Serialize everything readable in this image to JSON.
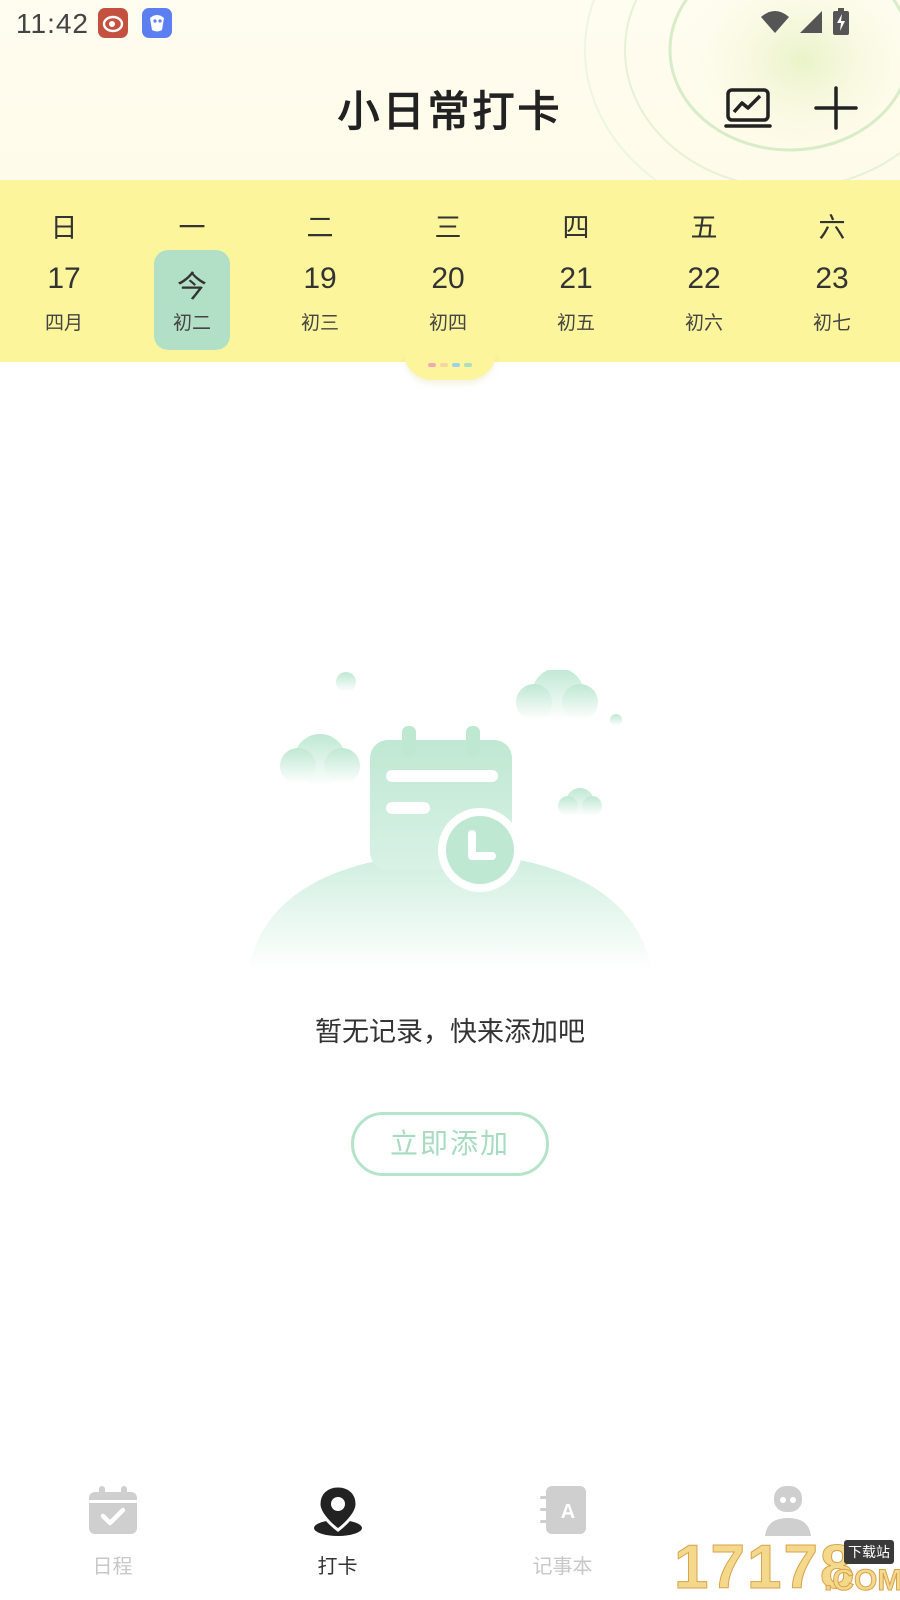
{
  "status_bar": {
    "time": "11:42"
  },
  "header": {
    "title": "小日常打卡",
    "stats_icon": "chart-icon",
    "add_icon": "plus-icon"
  },
  "week": {
    "weekdays": [
      "日",
      "一",
      "二",
      "三",
      "四",
      "五",
      "六"
    ],
    "days": [
      {
        "num": "17",
        "lunar": "四月",
        "today": false
      },
      {
        "num": "今",
        "lunar": "初二",
        "today": true
      },
      {
        "num": "19",
        "lunar": "初三",
        "today": false
      },
      {
        "num": "20",
        "lunar": "初四",
        "today": false
      },
      {
        "num": "21",
        "lunar": "初五",
        "today": false
      },
      {
        "num": "22",
        "lunar": "初六",
        "today": false
      },
      {
        "num": "23",
        "lunar": "初七",
        "today": false
      }
    ]
  },
  "empty": {
    "message": "暂无记录，快来添加吧",
    "button": "立即添加"
  },
  "bottom_nav": {
    "items": [
      {
        "label": "日程",
        "icon": "calendar-check-icon",
        "active": false
      },
      {
        "label": "打卡",
        "icon": "map-pin-icon",
        "active": true
      },
      {
        "label": "记事本",
        "icon": "notebook-icon",
        "active": false
      },
      {
        "label": "",
        "icon": "profile-icon",
        "active": false
      }
    ]
  },
  "watermark": {
    "number": "17178",
    "tag": "下载站",
    "suffix": ".COM"
  },
  "colors": {
    "header_bg": "#fffbea",
    "week_bg": "#fcf59c",
    "today_bg": "#b2e0c6",
    "accent_green": "#b6e4cb",
    "inactive_nav": "#c8c8c8"
  }
}
